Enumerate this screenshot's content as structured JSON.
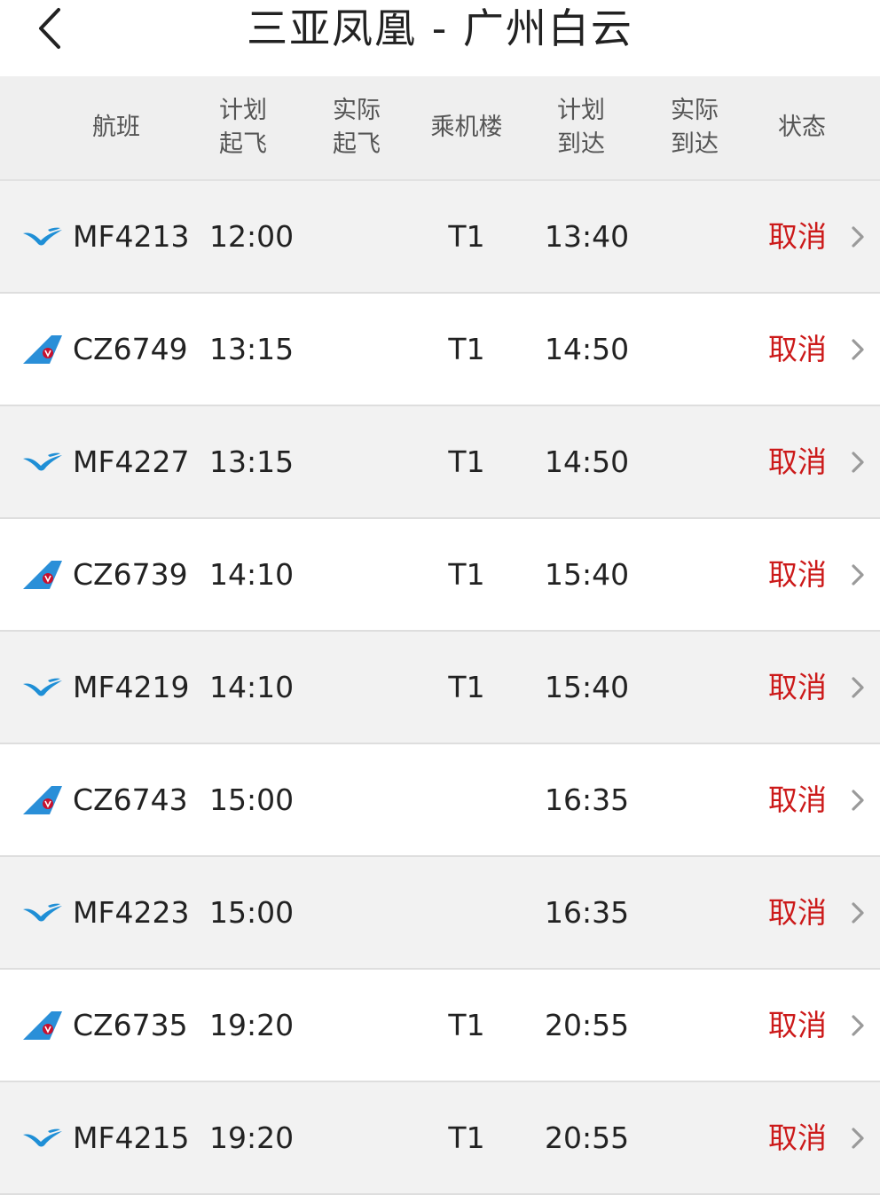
{
  "header": {
    "title": "三亚凤凰 - 广州白云",
    "back_icon": "chevron-left-icon"
  },
  "columns": {
    "flight": "航班",
    "sched_dep": "计划\n起飞",
    "actual_dep": "实际\n起飞",
    "terminal": "乘机楼",
    "sched_arr": "计划\n到达",
    "actual_arr": "实际\n到达",
    "status": "状态"
  },
  "colors": {
    "status_cancel": "#cc1a1a",
    "xiamen_airlines": "#1f8fd6",
    "china_southern_blue": "#2a8fd8",
    "china_southern_red": "#c8102e"
  },
  "flights": [
    {
      "airline": "xiamen-airlines-logo-icon",
      "flight_no": "MF4213",
      "sched_dep": "12:00",
      "actual_dep": "",
      "terminal": "T1",
      "sched_arr": "13:40",
      "actual_arr": "",
      "status": "取消"
    },
    {
      "airline": "china-southern-logo-icon",
      "flight_no": "CZ6749",
      "sched_dep": "13:15",
      "actual_dep": "",
      "terminal": "T1",
      "sched_arr": "14:50",
      "actual_arr": "",
      "status": "取消"
    },
    {
      "airline": "xiamen-airlines-logo-icon",
      "flight_no": "MF4227",
      "sched_dep": "13:15",
      "actual_dep": "",
      "terminal": "T1",
      "sched_arr": "14:50",
      "actual_arr": "",
      "status": "取消"
    },
    {
      "airline": "china-southern-logo-icon",
      "flight_no": "CZ6739",
      "sched_dep": "14:10",
      "actual_dep": "",
      "terminal": "T1",
      "sched_arr": "15:40",
      "actual_arr": "",
      "status": "取消"
    },
    {
      "airline": "xiamen-airlines-logo-icon",
      "flight_no": "MF4219",
      "sched_dep": "14:10",
      "actual_dep": "",
      "terminal": "T1",
      "sched_arr": "15:40",
      "actual_arr": "",
      "status": "取消"
    },
    {
      "airline": "china-southern-logo-icon",
      "flight_no": "CZ6743",
      "sched_dep": "15:00",
      "actual_dep": "",
      "terminal": "",
      "sched_arr": "16:35",
      "actual_arr": "",
      "status": "取消"
    },
    {
      "airline": "xiamen-airlines-logo-icon",
      "flight_no": "MF4223",
      "sched_dep": "15:00",
      "actual_dep": "",
      "terminal": "",
      "sched_arr": "16:35",
      "actual_arr": "",
      "status": "取消"
    },
    {
      "airline": "china-southern-logo-icon",
      "flight_no": "CZ6735",
      "sched_dep": "19:20",
      "actual_dep": "",
      "terminal": "T1",
      "sched_arr": "20:55",
      "actual_arr": "",
      "status": "取消"
    },
    {
      "airline": "xiamen-airlines-logo-icon",
      "flight_no": "MF4215",
      "sched_dep": "19:20",
      "actual_dep": "",
      "terminal": "T1",
      "sched_arr": "20:55",
      "actual_arr": "",
      "status": "取消"
    }
  ]
}
